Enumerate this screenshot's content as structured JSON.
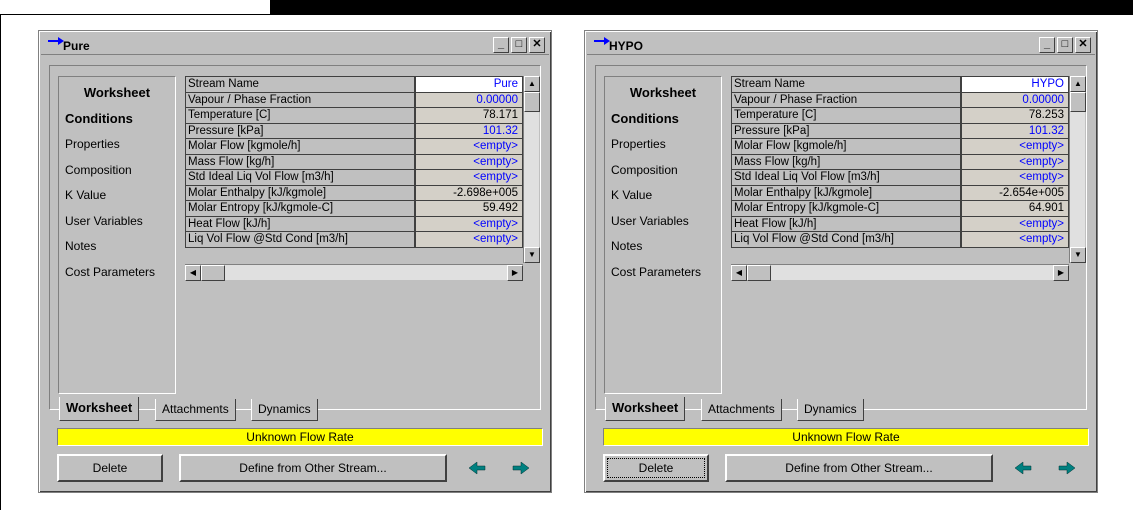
{
  "windows": [
    {
      "title": "Pure",
      "sidebar": {
        "header": "Worksheet",
        "items": [
          "Conditions",
          "Properties",
          "Composition",
          "K Value",
          "User Variables",
          "Notes",
          "Cost Parameters"
        ]
      },
      "grid": [
        {
          "label": "Stream Name",
          "value": "Pure"
        },
        {
          "label": "Vapour / Phase Fraction",
          "value": "0.00000"
        },
        {
          "label": "Temperature [C]",
          "value": "78.171"
        },
        {
          "label": "Pressure [kPa]",
          "value": "101.32"
        },
        {
          "label": "Molar Flow [kgmole/h]",
          "value": "<empty>"
        },
        {
          "label": "Mass Flow [kg/h]",
          "value": "<empty>"
        },
        {
          "label": "Std Ideal Liq Vol Flow [m3/h]",
          "value": "<empty>"
        },
        {
          "label": "Molar Enthalpy [kJ/kgmole]",
          "value": "-2.698e+005"
        },
        {
          "label": "Molar Entropy [kJ/kgmole-C]",
          "value": "59.492"
        },
        {
          "label": "Heat Flow [kJ/h]",
          "value": "<empty>"
        },
        {
          "label": "Liq Vol Flow @Std Cond [m3/h]",
          "value": "<empty>"
        }
      ],
      "tabs": [
        "Worksheet",
        "Attachments",
        "Dynamics"
      ],
      "status": "Unknown Flow Rate",
      "buttons": {
        "delete": "Delete",
        "define": "Define from Other Stream..."
      }
    },
    {
      "title": "HYPO",
      "sidebar": {
        "header": "Worksheet",
        "items": [
          "Conditions",
          "Properties",
          "Composition",
          "K Value",
          "User Variables",
          "Notes",
          "Cost Parameters"
        ]
      },
      "grid": [
        {
          "label": "Stream Name",
          "value": "HYPO"
        },
        {
          "label": "Vapour / Phase Fraction",
          "value": "0.00000"
        },
        {
          "label": "Temperature [C]",
          "value": "78.253"
        },
        {
          "label": "Pressure [kPa]",
          "value": "101.32"
        },
        {
          "label": "Molar Flow [kgmole/h]",
          "value": "<empty>"
        },
        {
          "label": "Mass Flow [kg/h]",
          "value": "<empty>"
        },
        {
          "label": "Std Ideal Liq Vol Flow [m3/h]",
          "value": "<empty>"
        },
        {
          "label": "Molar Enthalpy [kJ/kgmole]",
          "value": "-2.654e+005"
        },
        {
          "label": "Molar Entropy [kJ/kgmole-C]",
          "value": "64.901"
        },
        {
          "label": "Heat Flow [kJ/h]",
          "value": "<empty>"
        },
        {
          "label": "Liq Vol Flow @Std Cond [m3/h]",
          "value": "<empty>"
        }
      ],
      "tabs": [
        "Worksheet",
        "Attachments",
        "Dynamics"
      ],
      "status": "Unknown Flow Rate",
      "buttons": {
        "delete": "Delete",
        "define": "Define from Other Stream..."
      }
    }
  ],
  "colors": {
    "status_bg": "#ffff00",
    "value_blue": "#0000ff",
    "nav_arrow": "#008080",
    "title_arrow": "#0000ff"
  }
}
